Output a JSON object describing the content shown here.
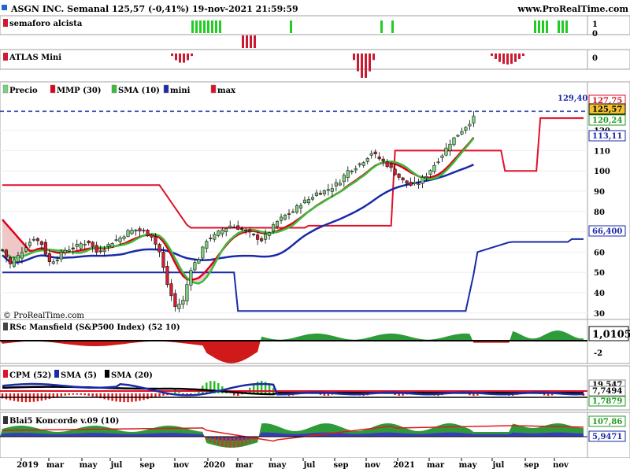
{
  "header": {
    "title": "ASGN INC. Semanal 125,57 (-0,41%) 19-nov-2021 21:59:59",
    "site": "www.ProRealTime.com",
    "watermark": "© ProRealTime.com"
  },
  "colors": {
    "up_candle": "#7ccf7c",
    "down_candle": "#cc2030",
    "mmp30": "#e0001a",
    "sma10": "#3bbb3b",
    "mini": "#1a2aa8",
    "max": "#e0102a",
    "fill_green": "#c7eec7",
    "fill_red": "#eec7c7",
    "dashed": "#1a2aa8",
    "semaforo": "#22cc22",
    "atlas": "#cc1a33"
  },
  "panels": {
    "semaforo": {
      "label": "semaforo alcista",
      "tick_top": "1",
      "tick_bottom": "0"
    },
    "atlas": {
      "label": "ATLAS Mini",
      "tick": "0"
    },
    "price": {
      "legend": [
        {
          "label": "Precio",
          "swatch": "#7ccf7c"
        },
        {
          "label": "MMP (30)",
          "swatch": "#e0001a"
        },
        {
          "label": "SMA (10)",
          "swatch": "#3bbb3b"
        },
        {
          "label": "mini",
          "swatch": "#1a2aa8"
        },
        {
          "label": "max",
          "swatch": "#e0102a"
        }
      ],
      "dashed_value_label": "129,40",
      "axis_labels": [
        "120",
        "110",
        "100",
        "90",
        "80",
        "70",
        "60",
        "50",
        "40",
        "30"
      ],
      "badges": [
        {
          "text": "127,75",
          "color": "#e0102a",
          "bg": "#ffffff"
        },
        {
          "text": "125,57",
          "color": "#000000",
          "bg": "#f2c230"
        },
        {
          "text": "120,24",
          "color": "#229922",
          "bg": "#ffffff"
        },
        {
          "text": "113,11",
          "color": "#1a2aa8",
          "bg": "#ffffff"
        },
        {
          "text": "66,400",
          "color": "#1a2aa8",
          "bg": "#ffffff"
        }
      ]
    },
    "rsc": {
      "label": "RSc Mansfield (S&P500 Index) (52 10)",
      "value": "1,0105",
      "tick_neg": "-2"
    },
    "cpm": {
      "legend": [
        {
          "label": "CPM (52)",
          "swatch": "#e0102a"
        },
        {
          "label": "SMA (5)",
          "swatch": "#1a2aa8"
        },
        {
          "label": "SMA (20)",
          "swatch": "#000000"
        }
      ],
      "values": [
        "19,547",
        "7,7494",
        "1,7879"
      ]
    },
    "konc": {
      "label": "Blai5 Koncorde v.09 (10)",
      "values": [
        "107,86",
        "5,9471"
      ]
    }
  },
  "x_axis": [
    "2019",
    "mar",
    "may",
    "jul",
    "sep",
    "nov",
    "2020",
    "mar",
    "may",
    "jul",
    "sep",
    "nov",
    "2021",
    "mar",
    "may",
    "jul",
    "sep",
    "nov"
  ],
  "chart_data": {
    "type": "candlestick",
    "title": "ASGN INC. Semanal 125,57 (-0,41%) 19-nov-2021 21:59:59",
    "ylim": [
      25,
      135
    ],
    "y_ticks": [
      30,
      40,
      50,
      60,
      70,
      80,
      90,
      100,
      110,
      120
    ],
    "price_anchors": {
      "t": [
        0,
        2,
        4,
        6,
        8,
        10,
        12,
        14,
        16,
        18,
        20,
        22,
        24,
        26,
        28,
        30,
        32,
        34,
        36,
        38,
        40,
        42,
        44,
        46,
        48,
        50,
        52,
        54,
        56,
        58,
        60,
        62,
        64,
        66,
        68,
        70,
        72,
        74,
        76,
        78,
        80,
        82,
        84,
        86,
        88,
        90,
        92,
        94,
        96,
        98,
        100,
        102,
        104,
        106,
        108,
        110,
        112,
        114,
        116,
        118,
        120,
        122,
        124,
        126,
        128,
        130,
        132,
        134,
        136,
        138,
        140,
        142,
        144,
        146,
        148
      ],
      "close": [
        61,
        54,
        58,
        63,
        67,
        64,
        55,
        57,
        61,
        62,
        64,
        65,
        60,
        62,
        65,
        67,
        70,
        71,
        70,
        68,
        60,
        44,
        33,
        36,
        52,
        57,
        66,
        68,
        71,
        73,
        72,
        70,
        68,
        66,
        70,
        75,
        78,
        80,
        84,
        86,
        89,
        90,
        92,
        95,
        100,
        102,
        105,
        109,
        106,
        103,
        99,
        95,
        93,
        94,
        98,
        103,
        108,
        114,
        118,
        122,
        126
      ],
      "note": "approximate weekly closes read from gridlines"
    },
    "mmp30": {
      "start": 76,
      "end": 121,
      "note": "weighted moving average"
    },
    "sma10": {
      "last": 120.24
    },
    "mini": {
      "last": 113.11
    },
    "max": {
      "last": 127.75
    },
    "extra_line": {
      "levels": [
        93,
        72,
        69,
        129.4
      ],
      "last": 66.4
    },
    "dashed_level": 129.4,
    "last_close": 125.57,
    "change_pct": -0.41,
    "rsc_last": 1.0105,
    "cpm_last": [
      19.547,
      7.7494,
      1.7879
    ],
    "koncorde_last": [
      107.86,
      5.9471
    ]
  }
}
